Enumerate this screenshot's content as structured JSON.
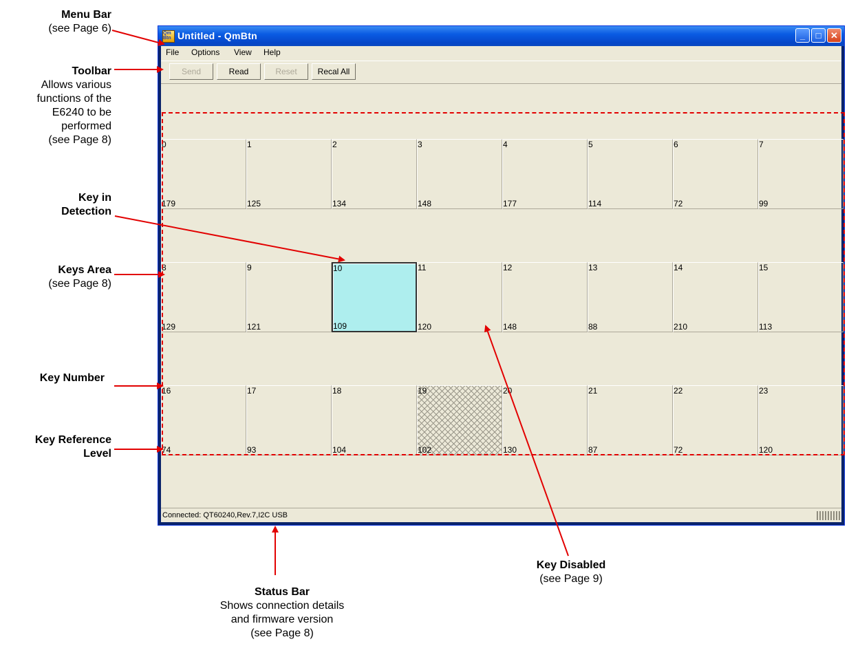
{
  "callouts": {
    "menu_bar": {
      "title": "Menu Bar",
      "lines": [
        "(see Page 6)"
      ]
    },
    "toolbar": {
      "title": "Toolbar",
      "lines": [
        "Allows various",
        "functions of the",
        "E6240 to be",
        "performed",
        "(see Page 8)"
      ]
    },
    "key_in_detection": {
      "lines": [
        "Key in",
        "Detection"
      ]
    },
    "keys_area": {
      "title": "Keys Area",
      "lines": [
        "(see Page 8)"
      ]
    },
    "key_number": {
      "title": "Key Number"
    },
    "key_reference_level": {
      "lines": [
        "Key Reference",
        "Level"
      ]
    },
    "status_bar": {
      "title": "Status Bar",
      "lines": [
        "Shows connection details",
        "and firmware version",
        "(see Page 8)"
      ]
    },
    "key_disabled": {
      "title": "Key Disabled",
      "lines": [
        "(see Page 9)"
      ]
    }
  },
  "window": {
    "title": "Untitled - QmBtn",
    "icon_text": "Qm Btn",
    "controls": {
      "minimize": "_",
      "maximize": "□",
      "close": "✕"
    }
  },
  "menu": [
    "File",
    "Options",
    "View",
    "Help"
  ],
  "toolbar": {
    "buttons": [
      {
        "label": "Send",
        "state": "disabled"
      },
      {
        "label": "Read",
        "state": "enabled"
      },
      {
        "label": "Reset",
        "state": "disabled"
      },
      {
        "label": "Recal All",
        "state": "enabled"
      }
    ]
  },
  "keys": [
    {
      "num": "0",
      "ref": "179"
    },
    {
      "num": "1",
      "ref": "125"
    },
    {
      "num": "2",
      "ref": "134"
    },
    {
      "num": "3",
      "ref": "148"
    },
    {
      "num": "4",
      "ref": "177"
    },
    {
      "num": "5",
      "ref": "114"
    },
    {
      "num": "6",
      "ref": "72"
    },
    {
      "num": "7",
      "ref": "99"
    },
    {
      "num": "8",
      "ref": "129"
    },
    {
      "num": "9",
      "ref": "121"
    },
    {
      "num": "10",
      "ref": "109",
      "state": "detect"
    },
    {
      "num": "11",
      "ref": "120"
    },
    {
      "num": "12",
      "ref": "148"
    },
    {
      "num": "13",
      "ref": "88"
    },
    {
      "num": "14",
      "ref": "210"
    },
    {
      "num": "15",
      "ref": "113"
    },
    {
      "num": "16",
      "ref": "74"
    },
    {
      "num": "17",
      "ref": "93"
    },
    {
      "num": "18",
      "ref": "104"
    },
    {
      "num": "19",
      "ref": "102",
      "state": "disabled"
    },
    {
      "num": "20",
      "ref": "130"
    },
    {
      "num": "21",
      "ref": "87"
    },
    {
      "num": "22",
      "ref": "72"
    },
    {
      "num": "23",
      "ref": "120"
    }
  ],
  "statusbar": {
    "text": "Connected: QT60240,Rev.7,I2C USB"
  },
  "colors": {
    "annotation": "#e20000",
    "detect_key": "#aeeeee",
    "titlebar": "#0a5be3",
    "client_bg": "#ece9d8"
  }
}
